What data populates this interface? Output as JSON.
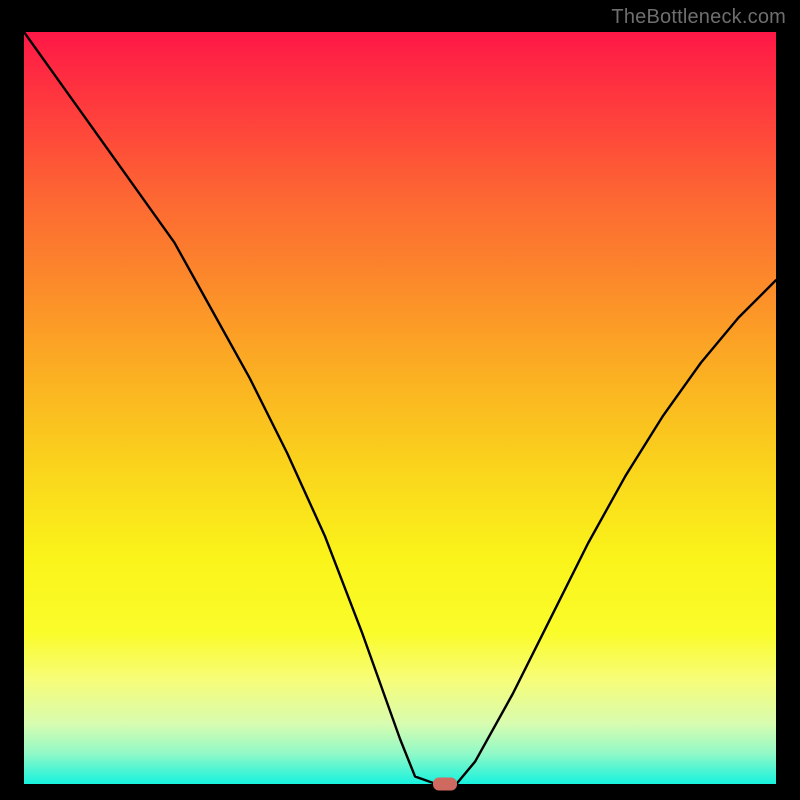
{
  "attribution": "TheBottleneck.com",
  "chart_data": {
    "type": "line",
    "title": "",
    "xlabel": "",
    "ylabel": "",
    "xlim": [
      0,
      100
    ],
    "ylim": [
      0,
      100
    ],
    "background_gradient": {
      "from": "#fe1847",
      "to": "#17f2de",
      "direction": "top-to-bottom",
      "meaning": "red=high bottleneck, green=low bottleneck"
    },
    "series": [
      {
        "name": "bottleneck-curve",
        "x": [
          0,
          5,
          10,
          15,
          20,
          25,
          30,
          35,
          40,
          45,
          50,
          52,
          54.8,
          57.5,
          60,
          65,
          70,
          75,
          80,
          85,
          90,
          95,
          100
        ],
        "values": [
          100,
          93,
          86,
          79,
          72,
          63,
          54,
          44,
          33,
          20,
          6,
          1,
          0,
          0,
          3,
          12,
          22,
          32,
          41,
          49,
          56,
          62,
          67
        ]
      }
    ],
    "marker": {
      "name": "minimum-point",
      "x": 56,
      "y": 0,
      "color": "#cf6a61"
    },
    "grid": false,
    "legend": false
  }
}
